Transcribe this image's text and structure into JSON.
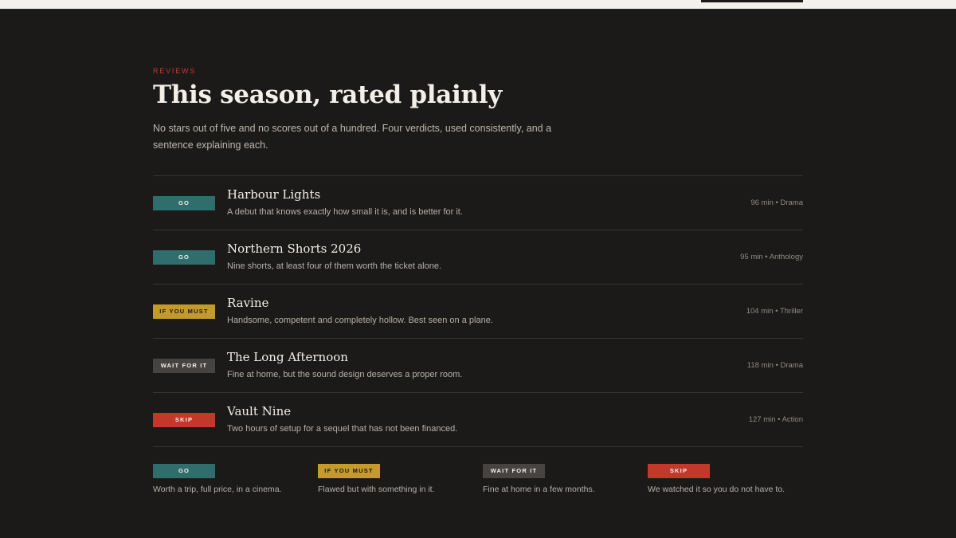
{
  "header": {
    "eyebrow": "REVIEWS",
    "title": "This season, rated plainly",
    "intro": "No stars out of five and no scores out of a hundred. Four verdicts, used consistently, and a sentence explaining each."
  },
  "films": [
    {
      "verdict": "GO",
      "verdict_key": "go",
      "title": "Harbour Lights",
      "desc": "A debut that knows exactly how small it is, and is better for it.",
      "meta": "96 min • Drama"
    },
    {
      "verdict": "GO",
      "verdict_key": "go",
      "title": "Northern Shorts 2026",
      "desc": "Nine shorts, at least four of them worth the ticket alone.",
      "meta": "95 min • Anthology"
    },
    {
      "verdict": "IF YOU MUST",
      "verdict_key": "must",
      "title": "Ravine",
      "desc": "Handsome, competent and completely hollow. Best seen on a plane.",
      "meta": "104 min • Thriller"
    },
    {
      "verdict": "WAIT FOR IT",
      "verdict_key": "wait",
      "title": "The Long Afternoon",
      "desc": "Fine at home, but the sound design deserves a proper room.",
      "meta": "118 min • Drama"
    },
    {
      "verdict": "SKIP",
      "verdict_key": "skip",
      "title": "Vault Nine",
      "desc": "Two hours of setup for a sequel that has not been financed.",
      "meta": "127 min • Action"
    }
  ],
  "legend": [
    {
      "verdict": "GO",
      "desc": "Worth a trip, full price, in a cinema."
    },
    {
      "verdict": "IF YOU MUST",
      "desc": "Flawed but with something in it."
    },
    {
      "verdict": "WAIT FOR IT",
      "desc": "Fine at home in a few months."
    },
    {
      "verdict": "SKIP",
      "desc": "We watched it so you do not have to."
    }
  ],
  "colors": {
    "background": "#1c1a19",
    "go": "#2f6e6c",
    "if_you_must": "#c49a2a",
    "wait_for_it": "#464341",
    "skip": "#c2392c",
    "accent": "#c23a2b"
  }
}
